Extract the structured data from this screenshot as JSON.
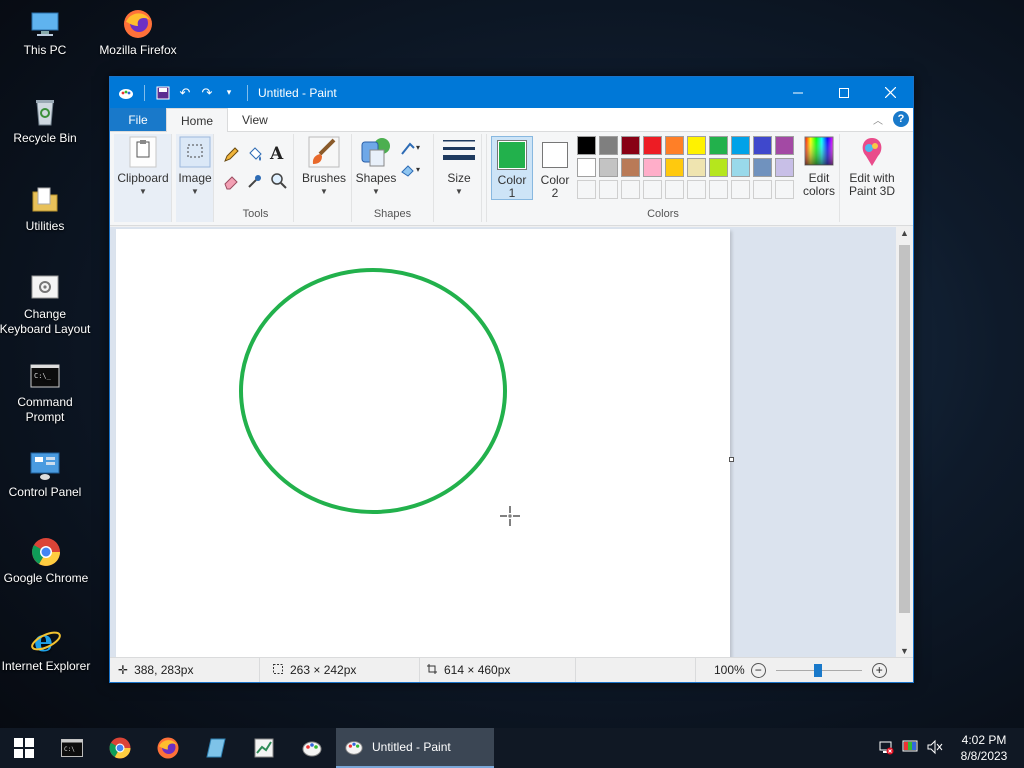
{
  "desktop": {
    "icons": [
      {
        "label": "This PC"
      },
      {
        "label": "Mozilla Firefox"
      },
      {
        "label": "Recycle Bin"
      },
      {
        "label": "Utilities"
      },
      {
        "label": "Change Keyboard Layout"
      },
      {
        "label": "Command Prompt"
      },
      {
        "label": "Control Panel"
      },
      {
        "label": "Google Chrome"
      },
      {
        "label": "Internet Explorer"
      }
    ]
  },
  "window": {
    "title": "Untitled - Paint",
    "tabs": {
      "file": "File",
      "home": "Home",
      "view": "View"
    },
    "help": "?"
  },
  "ribbon": {
    "clipboard": "Clipboard",
    "image": "Image",
    "tools_label": "Tools",
    "brushes": "Brushes",
    "shapes": "Shapes",
    "shapes_label": "Shapes",
    "size": "Size",
    "color1_line1": "Color",
    "color1_line2": "1",
    "color2_line1": "Color",
    "color2_line2": "2",
    "colors_label": "Colors",
    "edit_colors_line1": "Edit",
    "edit_colors_line2": "colors",
    "paint3d_line1": "Edit with",
    "paint3d_line2": "Paint 3D"
  },
  "colors": {
    "color1": "#22b14c",
    "color2": "#ffffff",
    "row1": [
      "#000000",
      "#7f7f7f",
      "#880015",
      "#ed1c24",
      "#ff7f27",
      "#fff200",
      "#22b14c",
      "#00a2e8",
      "#3f48cc",
      "#a349a4"
    ],
    "row2": [
      "#ffffff",
      "#c3c3c3",
      "#b97a57",
      "#ffaec9",
      "#ffc90e",
      "#efe4b0",
      "#b5e61d",
      "#99d9ea",
      "#7092be",
      "#c8bfe7"
    ]
  },
  "canvas": {
    "ellipse_color": "#22b14c"
  },
  "status": {
    "cursor": "388, 283px",
    "selection": "263 × 242px",
    "image_size": "614 × 460px",
    "zoom": "100%"
  },
  "taskbar": {
    "active_app": "Untitled - Paint",
    "time": "4:02 PM",
    "date": "8/8/2023"
  }
}
